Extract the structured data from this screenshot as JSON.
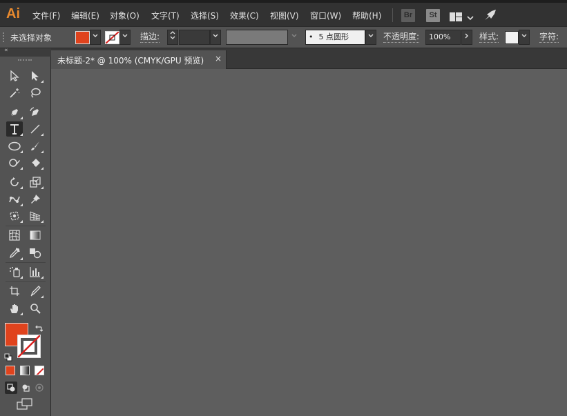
{
  "app": {
    "logo": "Ai"
  },
  "menu": {
    "items": [
      "文件(F)",
      "编辑(E)",
      "对象(O)",
      "文字(T)",
      "选择(S)",
      "效果(C)",
      "视图(V)",
      "窗口(W)",
      "帮助(H)"
    ],
    "bridge_badge": "Br",
    "stock_badge": "St",
    "icons": [
      "workspace-layout-icon",
      "chevron-down-icon",
      "rocket-icon"
    ]
  },
  "control_bar": {
    "selection_status": "未选择对象",
    "fill_color": "#e0431d",
    "stroke_label": "描边",
    "stroke_separator": ":",
    "brush_dot": "•",
    "brush_size": "5",
    "brush_shape": "点圆形",
    "opacity_label": "不透明度",
    "opacity_separator": ":",
    "opacity_value": "100%",
    "style_label": "样式",
    "style_separator": ":",
    "char_label": "字符",
    "char_separator": ":",
    "colors": {
      "fill": "#e0431d",
      "none_slash": "#d9201e"
    }
  },
  "toolbar": {
    "collapse_glyph": "«",
    "active_tool": "type-tool",
    "default_fill": "#e0431d",
    "tools": [
      "selection-tool",
      "direct-selection-tool",
      "magic-wand-tool",
      "lasso-tool",
      "pen-tool",
      "curvature-tool",
      "type-tool",
      "line-segment-tool",
      "ellipse-tool",
      "paintbrush-tool",
      "shaper-tool",
      "eraser-tool",
      "rotate-tool",
      "scale-tool",
      "puppet-warp-tool",
      "pin-tool",
      "free-transform-tool",
      "perspective-grid-tool",
      "mesh-tool",
      "gradient-tool",
      "eyedropper-tool",
      "blend-tool",
      "symbol-sprayer-tool",
      "column-graph-tool",
      "artboard-tool",
      "slice-tool",
      "hand-tool",
      "zoom-tool"
    ]
  },
  "document": {
    "tab_title": "未标题-2* @ 100% (CMYK/GPU 预览)",
    "close_glyph": "×"
  },
  "colors": {
    "menubar_bg": "#323232",
    "panel_bg": "#535353",
    "canvas_bg": "#5e5e5e",
    "logo": "#e98a2e"
  }
}
